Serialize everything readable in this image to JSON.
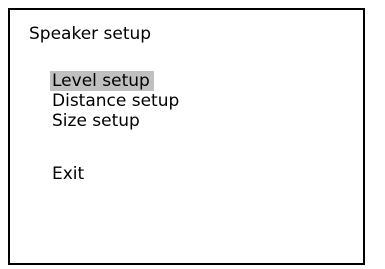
{
  "dialog": {
    "title": "Speaker setup"
  },
  "menu": {
    "selected_index": 0,
    "items": [
      {
        "label": "Level setup"
      },
      {
        "label": "Distance setup"
      },
      {
        "label": "Size setup"
      }
    ],
    "exit_label": "Exit"
  },
  "colors": {
    "highlight": "#c0c0c0",
    "border": "#000000",
    "background": "#ffffff",
    "text": "#000000"
  }
}
